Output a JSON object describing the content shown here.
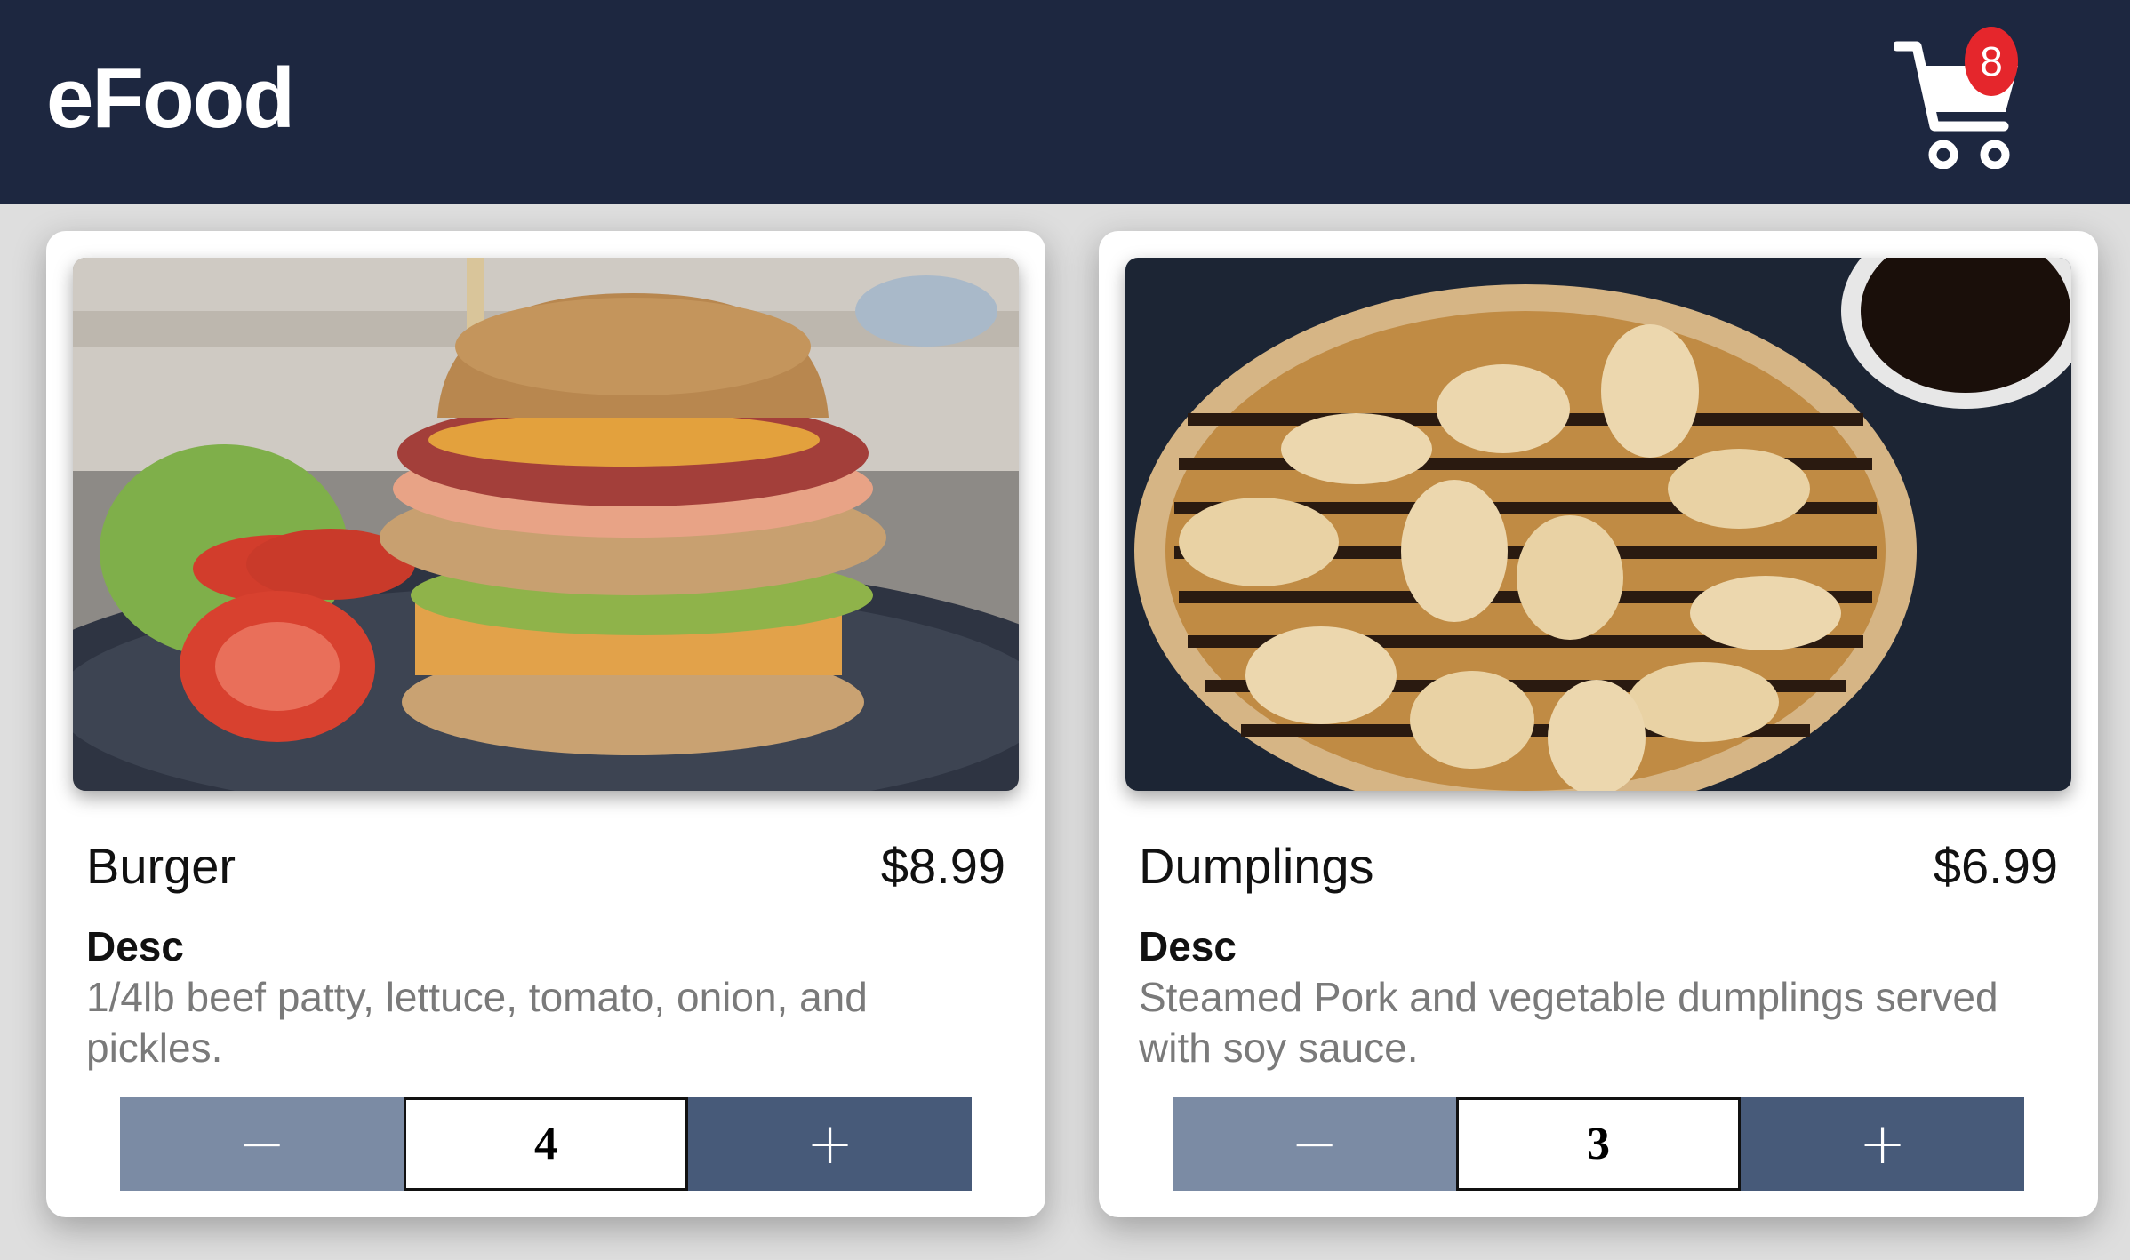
{
  "header": {
    "brand": "eFood",
    "cart_icon": "shopping-cart-icon",
    "cart_count": "8",
    "background": "#1d2740",
    "badge_color": "#e5262c"
  },
  "products": [
    {
      "name": "Burger",
      "price": "$8.99",
      "desc_label": "Desc",
      "description": "1/4lb beef patty, lettuce, tomato, onion, and pickles.",
      "quantity": "4",
      "minus_label": "−",
      "plus_label": "+"
    },
    {
      "name": "Dumplings",
      "price": "$6.99",
      "desc_label": "Desc",
      "description": "Steamed Pork and vegetable dumplings served with soy sauce.",
      "quantity": "3",
      "minus_label": "−",
      "plus_label": "+"
    }
  ],
  "colors": {
    "minus_button": "#7b8ba4",
    "plus_button": "#475a79"
  }
}
